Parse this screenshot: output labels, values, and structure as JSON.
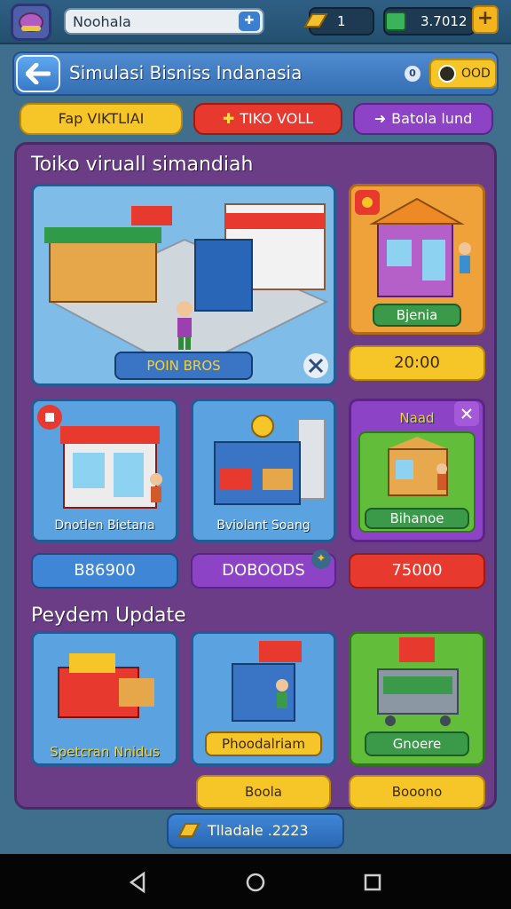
{
  "topbar": {
    "search_value": "Noohala",
    "resource_1_value": "1",
    "resource_2_value": "3.7012",
    "plus_label": "+"
  },
  "titlebar": {
    "title": "Simulasi Bisniss Indanasia",
    "info_label": "0",
    "coin_button_label": "OOD"
  },
  "filters": [
    {
      "label": "Fap VIKTLIAI"
    },
    {
      "label": "TIKO VOLL"
    },
    {
      "label": "Batola lund"
    }
  ],
  "sections": {
    "virtual_store_title": "Toiko viruall simandiah",
    "update_title": "Peydem Update"
  },
  "stores": {
    "main_store_label": "POIN BROS",
    "side_store_label": "Bjenia",
    "side_store_price": "20:00",
    "card2_label": "Dnotlen Bietana",
    "card3_label": "Bviolant Soang",
    "card4_tag": "Naad",
    "card4_label": "Bihanoe",
    "value_1": "B86900",
    "value_2": "DOBOODS",
    "value_3": "75000"
  },
  "updates": {
    "item1_label": "Spetcran Nnidus",
    "item2_label": "Phoodalriam",
    "item3_label": "Gnoere",
    "button_1": "Boola",
    "button_2": "Booono"
  },
  "footer": {
    "label": "Tlladale .2223"
  },
  "colors": {
    "panel": "#6a3d86",
    "accent_yellow": "#f6c528",
    "accent_red": "#e8392e",
    "accent_purple": "#8d43c6",
    "card_blue": "#5aa2e0",
    "card_orange": "#f0a23a",
    "card_green": "#62be3a"
  }
}
